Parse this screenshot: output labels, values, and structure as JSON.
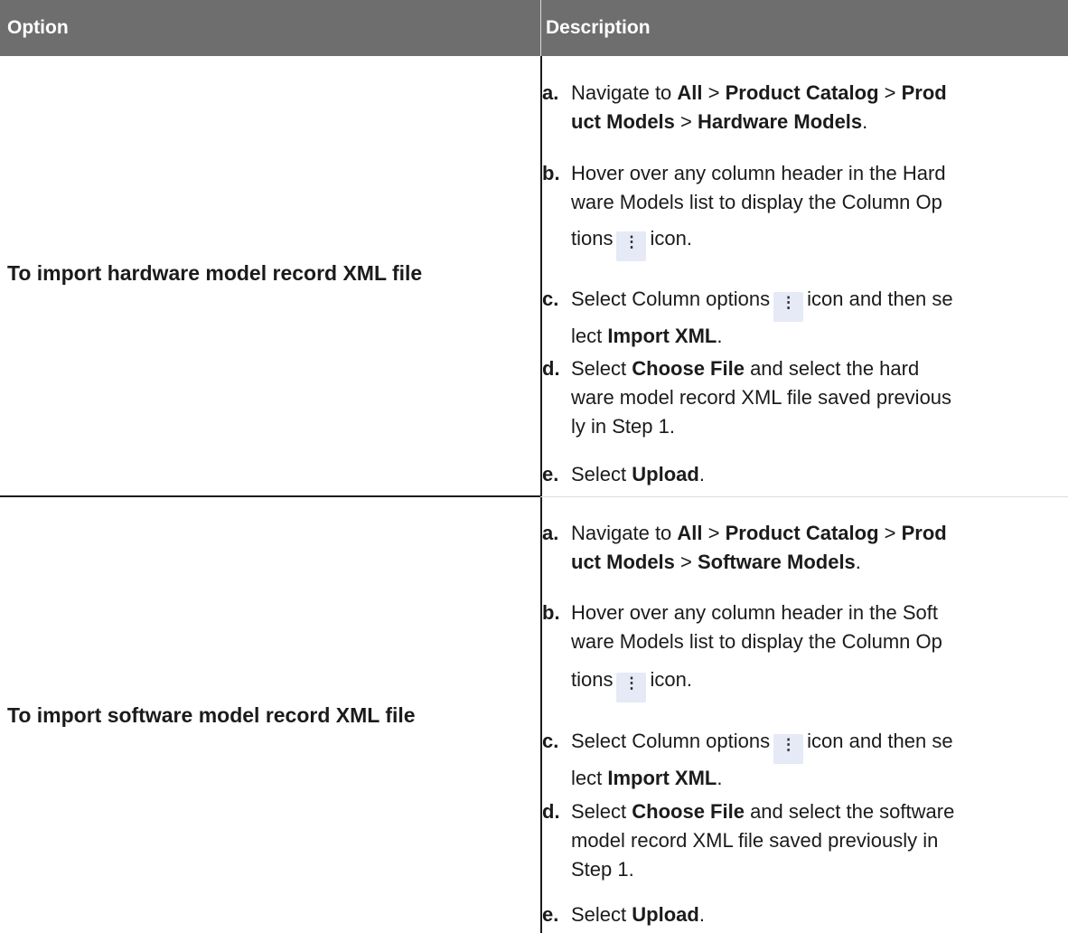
{
  "table": {
    "headers": {
      "option": "Option",
      "description": "Description"
    },
    "rows": [
      {
        "option": "To import hardware model record XML file",
        "steps": {
          "a": {
            "marker": "a.",
            "l1_pre": "Navigate to ",
            "l1_all": "All",
            "l1_sep1": " > ",
            "l1_pc": "Product Catalog",
            "l1_sep2": " > ",
            "l1_prod": "Prod",
            "l2_uct": "uct Models",
            "l2_sep3": " > ",
            "l2_model": "Hardware Models",
            "l2_end": "."
          },
          "b": {
            "marker": "b.",
            "l1": "Hover over any column header in the Hard",
            "l2": "ware Models list to display the Column Op",
            "l3_pre": "tions",
            "l3_post": "icon."
          },
          "c": {
            "marker": "c.",
            "l1_pre": "Select Column options",
            "l1_post": "icon and then se",
            "l2_pre": "lect ",
            "l2_bold": "Import XML",
            "l2_end": "."
          },
          "d": {
            "marker": "d.",
            "l1_pre": "Select ",
            "l1_bold": "Choose File",
            "l1_post": " and select the hard",
            "l2": "ware model record XML file saved previous",
            "l3": "ly in Step 1."
          },
          "e": {
            "marker": "e.",
            "pre": "Select ",
            "bold": "Upload",
            "end": "."
          }
        }
      },
      {
        "option": "To import software model record XML file",
        "steps": {
          "a": {
            "marker": "a.",
            "l1_pre": "Navigate to ",
            "l1_all": "All",
            "l1_sep1": " > ",
            "l1_pc": "Product Catalog",
            "l1_sep2": " > ",
            "l1_prod": "Prod",
            "l2_uct": "uct Models",
            "l2_sep3": " > ",
            "l2_model": "Software Models",
            "l2_end": "."
          },
          "b": {
            "marker": "b.",
            "l1": "Hover over any column header in the Soft",
            "l2": "ware Models list to display the Column Op",
            "l3_pre": "tions",
            "l3_post": "icon."
          },
          "c": {
            "marker": "c.",
            "l1_pre": "Select Column options",
            "l1_post": "icon and then se",
            "l2_pre": "lect ",
            "l2_bold": "Import XML",
            "l2_end": "."
          },
          "d": {
            "marker": "d.",
            "l1_pre": "Select ",
            "l1_bold": "Choose File",
            "l1_post": " and select the software",
            "l2": "model record XML file saved previously in",
            "l3": "Step 1."
          },
          "e": {
            "marker": "e.",
            "pre": "Select ",
            "bold": "Upload",
            "end": "."
          }
        }
      }
    ]
  },
  "icons": {
    "column_options": "vertical-ellipsis-icon",
    "glyph": "⋮"
  }
}
